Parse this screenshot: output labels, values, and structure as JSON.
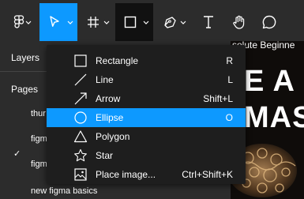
{
  "toolbar": {
    "tools": [
      {
        "name": "main-menu",
        "icon": "figma-logo-icon"
      },
      {
        "name": "move-tool",
        "icon": "cursor-arrow-icon",
        "active": true
      },
      {
        "name": "frame-tool",
        "icon": "hash-frame-icon"
      },
      {
        "name": "shape-tool",
        "icon": "square-icon",
        "open": true
      },
      {
        "name": "pen-tool",
        "icon": "pen-nib-icon"
      },
      {
        "name": "text-tool",
        "icon": "text-t-icon"
      },
      {
        "name": "hand-tool",
        "icon": "hand-icon"
      },
      {
        "name": "comment-tool",
        "icon": "comment-bubble-icon"
      }
    ],
    "accent": "#0d99ff"
  },
  "left_panel": {
    "layers_label": "Layers",
    "pages_label": "Pages",
    "pages": [
      "thur",
      "figm",
      "figm",
      "new figma basics"
    ]
  },
  "canvas": {
    "heading_fragment": "solute Beginne",
    "big_line1": "E A",
    "big_line2": "MAS"
  },
  "shape_menu": {
    "items": [
      {
        "label": "Rectangle",
        "shortcut": "R",
        "icon": "rectangle-icon",
        "active": false
      },
      {
        "label": "Line",
        "shortcut": "L",
        "icon": "line-icon",
        "active": false
      },
      {
        "label": "Arrow",
        "shortcut": "Shift+L",
        "icon": "arrow-icon",
        "active": false
      },
      {
        "label": "Ellipse",
        "shortcut": "O",
        "icon": "ellipse-icon",
        "active": true
      },
      {
        "label": "Polygon",
        "shortcut": "",
        "icon": "polygon-icon",
        "active": false
      },
      {
        "label": "Star",
        "shortcut": "",
        "icon": "star-icon",
        "active": false
      },
      {
        "label": "Place image...",
        "shortcut": "Ctrl+Shift+K",
        "icon": "image-icon",
        "active": false
      }
    ]
  }
}
